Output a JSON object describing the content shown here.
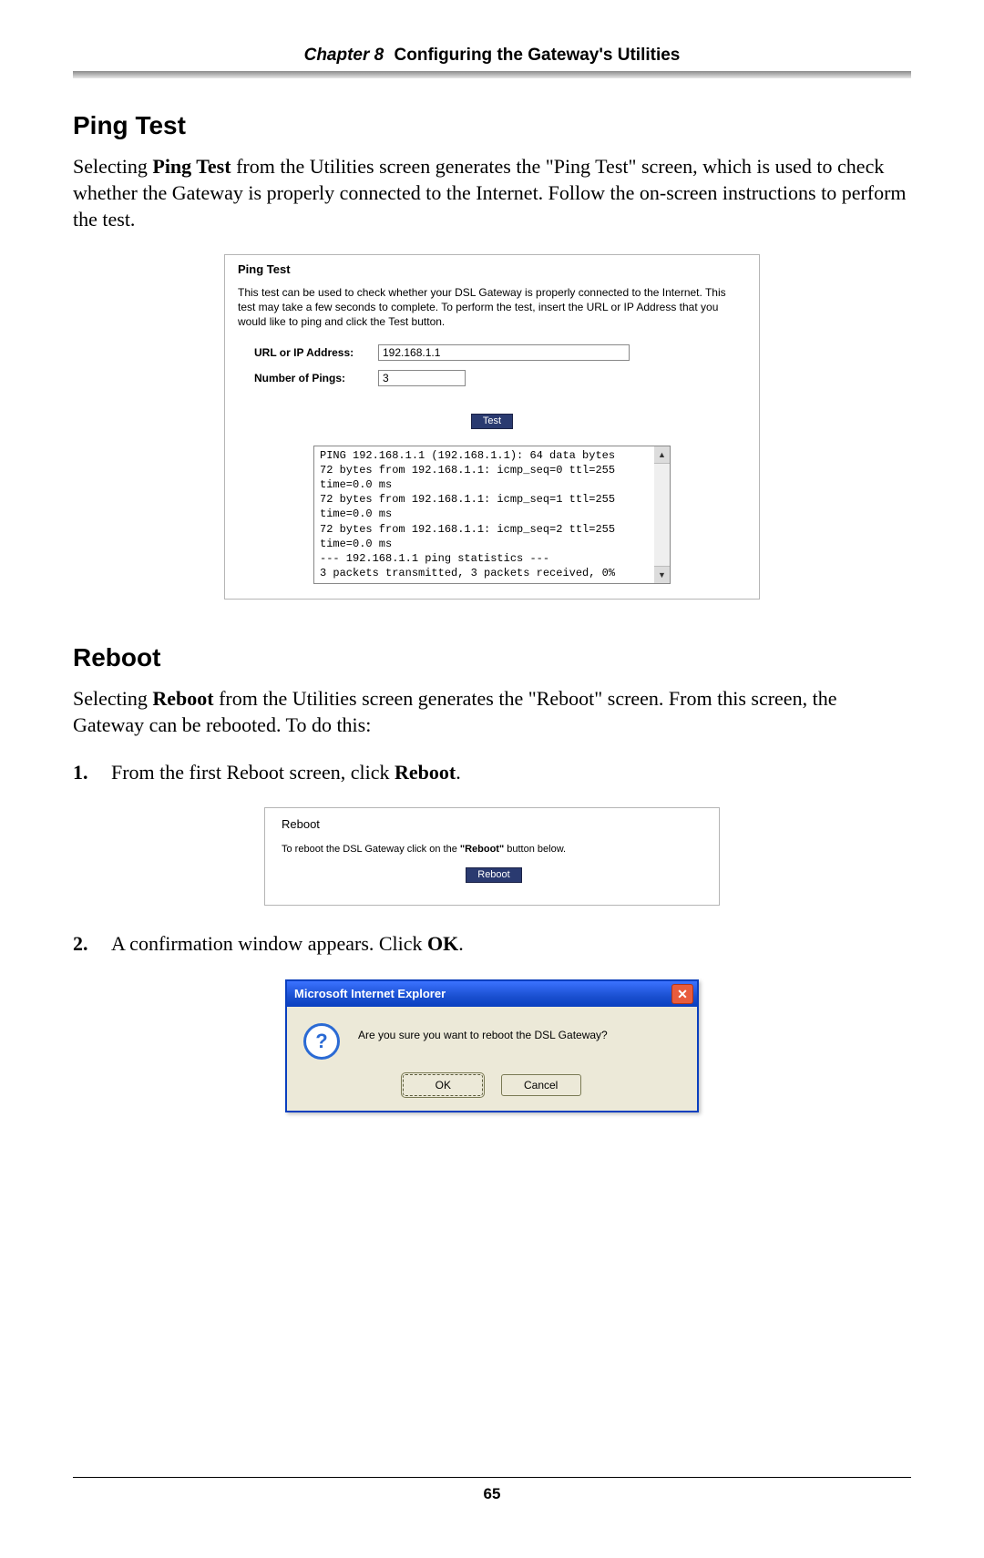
{
  "header": {
    "chapter": "Chapter 8",
    "title": " Configuring the Gateway's Utilities"
  },
  "ping_section": {
    "heading": "Ping Test",
    "para_pre": "Selecting ",
    "para_bold": "Ping Test",
    "para_post": " from the Utilities screen generates the \"Ping Test\" screen, which is used to check whether the Gateway is properly connected to the Internet. Follow the on-screen instructions to perform the test."
  },
  "ping_mock": {
    "title": "Ping Test",
    "description": "This test can be used to check whether your DSL Gateway is properly connected to the Internet. This test may take a few seconds to complete. To perform the test, insert the URL or IP Address that you would like to ping and click the Test button.",
    "url_label": "URL or IP Address:",
    "url_value": "192.168.1.1",
    "pings_label": "Number of Pings:",
    "pings_value": "3",
    "test_button": "Test",
    "output": [
      "PING 192.168.1.1 (192.168.1.1): 64 data bytes",
      "72 bytes from 192.168.1.1: icmp_seq=0 ttl=255 time=0.0 ms",
      "72 bytes from 192.168.1.1: icmp_seq=1 ttl=255 time=0.0 ms",
      "72 bytes from 192.168.1.1: icmp_seq=2 ttl=255 time=0.0 ms",
      "",
      "--- 192.168.1.1 ping statistics ---",
      "3 packets transmitted, 3 packets received, 0%"
    ]
  },
  "reboot_section": {
    "heading": "Reboot",
    "para_pre": "Selecting ",
    "para_bold": "Reboot",
    "para_post": " from the Utilities screen generates the \"Reboot\" screen. From this screen, the Gateway can be rebooted. To do this:"
  },
  "steps": {
    "s1_num": "1.",
    "s1_pre": "From the first Reboot screen, click ",
    "s1_bold": "Reboot",
    "s1_post": ".",
    "s2_num": "2.",
    "s2_pre": "A confirmation window appears. Click ",
    "s2_bold": "OK",
    "s2_post": "."
  },
  "reboot_mock": {
    "title": "Reboot",
    "instr_pre": "To reboot the DSL Gateway click on the ",
    "instr_bold": "\"Reboot\"",
    "instr_post": " button below.",
    "button": "Reboot"
  },
  "dialog": {
    "title": "Microsoft Internet Explorer",
    "icon_char": "?",
    "close_char": "✕",
    "message": "Are you sure you want to reboot the DSL Gateway?",
    "ok": "OK",
    "cancel": "Cancel"
  },
  "page_number": "65",
  "scroll_arrows": {
    "up": "▲",
    "down": "▼"
  }
}
